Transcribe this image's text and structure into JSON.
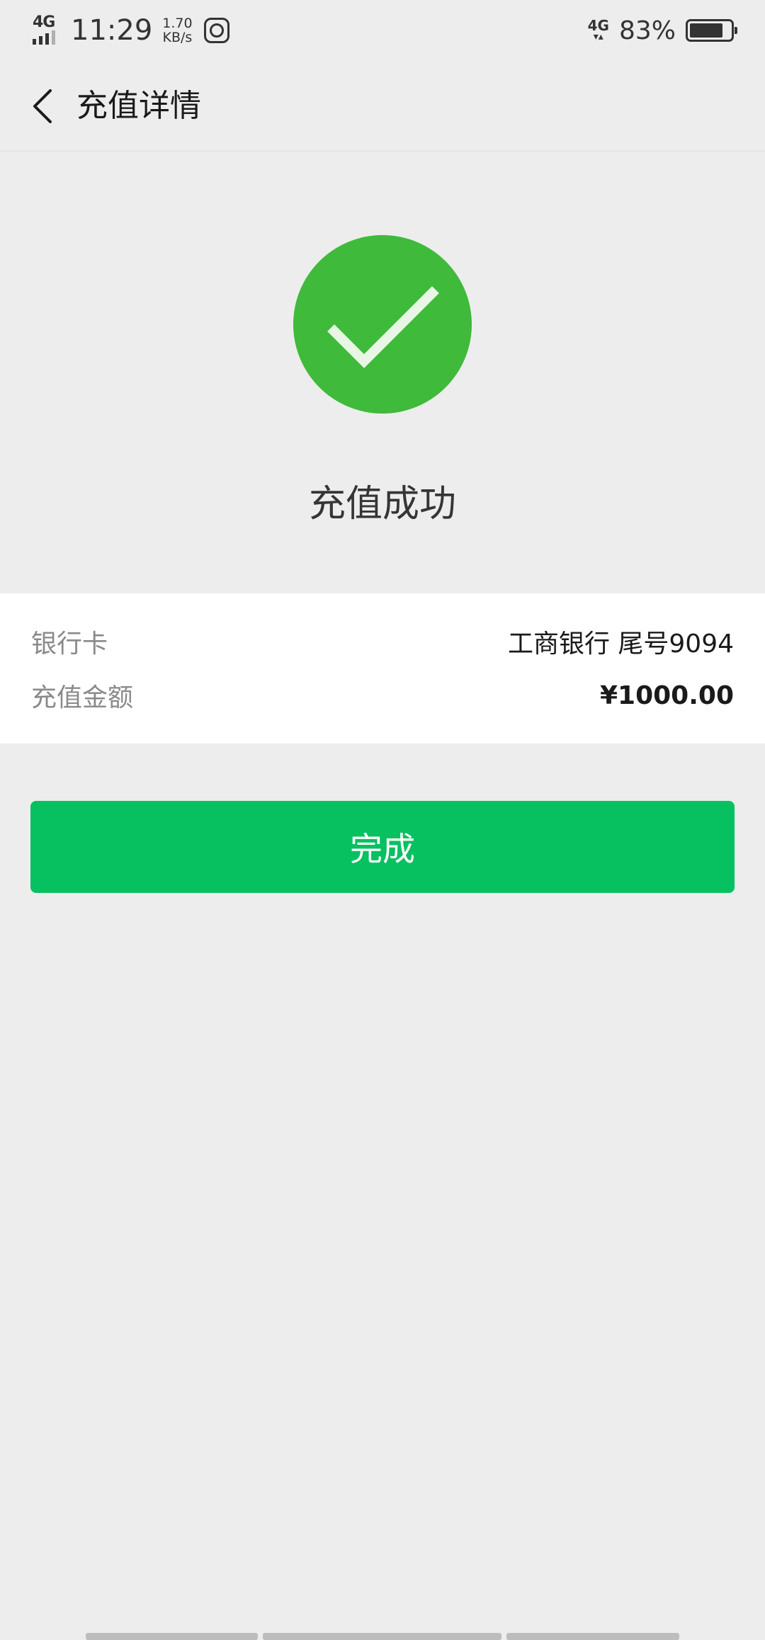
{
  "status_bar": {
    "signal_left": "4G",
    "time": "11:29",
    "net_speed_value": "1.70",
    "net_speed_unit": "KB/s",
    "signal_right": "4G",
    "battery_percent": "83%",
    "battery_level": 0.83,
    "icons": [
      "signal-icon",
      "app-notification-icon",
      "signal-4g-icon",
      "battery-icon"
    ]
  },
  "nav": {
    "title": "充值详情",
    "back_icon": "chevron-left-icon"
  },
  "result": {
    "title": "充值成功",
    "icon": "check-circle-icon",
    "accent_color": "#3fba3a"
  },
  "details": [
    {
      "label": "银行卡",
      "value": "工商银行 尾号9094"
    },
    {
      "label": "充值金额",
      "value": "¥1000.00"
    }
  ],
  "actions": {
    "done_label": "完成",
    "button_color": "#07c160"
  }
}
